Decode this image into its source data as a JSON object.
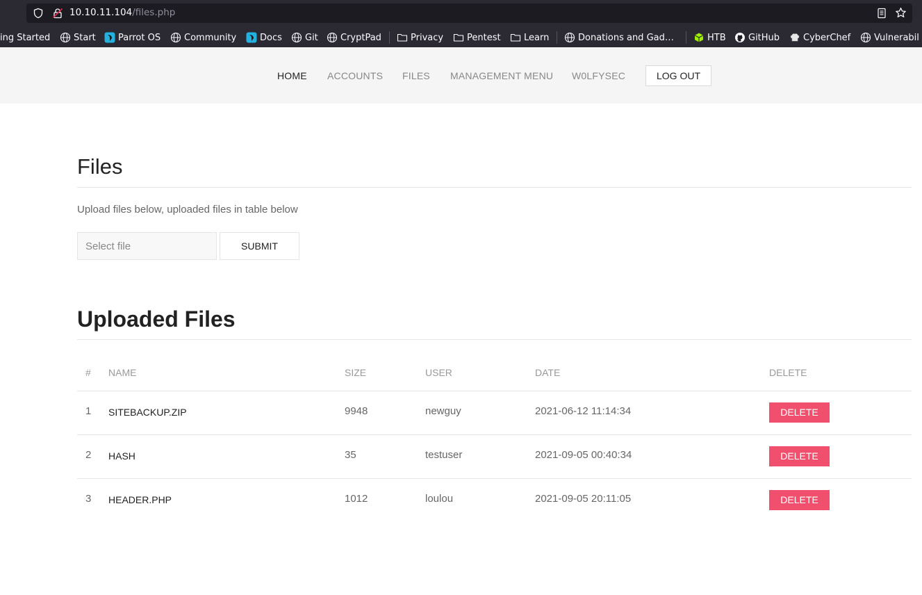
{
  "browser": {
    "url_host": "10.10.11.104",
    "url_path": "/files.php",
    "bookmarks": [
      {
        "label": "ing Started",
        "icon": "none"
      },
      {
        "label": "Start",
        "icon": "globe-icon"
      },
      {
        "label": "Parrot OS",
        "icon": "parrot-icon"
      },
      {
        "label": "Community",
        "icon": "globe-icon"
      },
      {
        "label": "Docs",
        "icon": "parrot-icon"
      },
      {
        "label": "Git",
        "icon": "globe-icon"
      },
      {
        "label": "CryptPad",
        "icon": "globe-icon"
      },
      {
        "label": "Privacy",
        "icon": "folder-icon"
      },
      {
        "label": "Pentest",
        "icon": "folder-icon"
      },
      {
        "label": "Learn",
        "icon": "folder-icon"
      },
      {
        "label": "Donations and Gad…",
        "icon": "globe-icon"
      },
      {
        "label": "HTB",
        "icon": "htb-cube-icon"
      },
      {
        "label": "GitHub",
        "icon": "github-icon"
      },
      {
        "label": "CyberChef",
        "icon": "chef-hat-icon"
      },
      {
        "label": "Vulnerabil",
        "icon": "globe-icon"
      }
    ]
  },
  "nav": {
    "items": [
      "HOME",
      "ACCOUNTS",
      "FILES",
      "MANAGEMENT MENU",
      "W0LFYSEC"
    ],
    "logout": "LOG OUT"
  },
  "files": {
    "title": "Files",
    "description": "Upload files below, uploaded files in table below",
    "file_placeholder": "Select file",
    "submit": "SUBMIT"
  },
  "uploaded": {
    "title": "Uploaded Files",
    "columns": [
      "#",
      "NAME",
      "SIZE",
      "USER",
      "DATE",
      "DELETE"
    ],
    "rows": [
      {
        "num": "1",
        "name": "SITEBACKUP.ZIP",
        "size": "9948",
        "user": "newguy",
        "date": "2021-06-12 11:14:34",
        "action": "DELETE"
      },
      {
        "num": "2",
        "name": "HASH",
        "size": "35",
        "user": "testuser",
        "date": "2021-09-05 00:40:34",
        "action": "DELETE"
      },
      {
        "num": "3",
        "name": "HEADER.PHP",
        "size": "1012",
        "user": "loulou",
        "date": "2021-09-05 20:11:05",
        "action": "DELETE"
      }
    ]
  },
  "colors": {
    "delete_button": "#f0506e",
    "nav_background": "#f5f5f5",
    "browser_chrome": "#2b2a33"
  }
}
